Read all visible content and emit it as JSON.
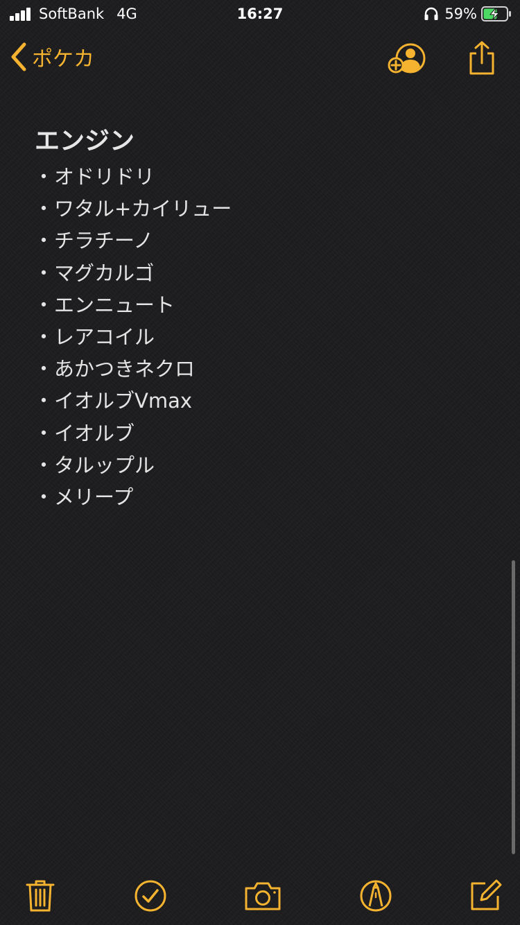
{
  "status_bar": {
    "carrier": "SoftBank",
    "network": "4G",
    "time": "16:27",
    "battery_percent": "59%",
    "battery_level": 0.59,
    "headphones_icon": "headphones-icon",
    "charging_icon": "bolt-icon"
  },
  "nav": {
    "back_label": "ポケカ",
    "back_icon": "chevron-left-icon",
    "collab_icon": "add-person-icon",
    "share_icon": "share-icon"
  },
  "note": {
    "title": "エンジン",
    "bullet": "・",
    "items": [
      "オドリドリ",
      "ワタル+カイリュー",
      "チラチーノ",
      "マグカルゴ",
      "エンニュート",
      "レアコイル",
      "あかつきネクロ",
      "イオルブVmax",
      "イオルブ",
      "タルップル",
      "メリープ"
    ]
  },
  "toolbar": {
    "delete_icon": "trash-icon",
    "checklist_icon": "checkmark-circle-icon",
    "camera_icon": "camera-icon",
    "markup_icon": "pen-circle-icon",
    "compose_icon": "compose-icon"
  },
  "colors": {
    "accent": "#f5b32f",
    "background": "#1c1c1e",
    "text": "#e4e4e4",
    "battery_fill": "#4cd964"
  }
}
